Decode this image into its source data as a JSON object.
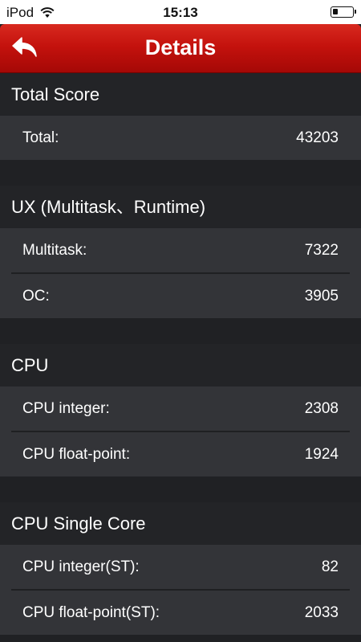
{
  "status_bar": {
    "device": "iPod",
    "time": "15:13",
    "battery_level": 0.25
  },
  "header": {
    "title": "Details",
    "back_icon": "back-arrow-icon",
    "accent_color": "#c4120d"
  },
  "sections": [
    {
      "title": "Total Score",
      "rows": [
        {
          "label": "Total:",
          "value": "43203"
        }
      ]
    },
    {
      "title": "UX (Multitask、Runtime)",
      "rows": [
        {
          "label": "Multitask:",
          "value": "7322"
        },
        {
          "label": "OC:",
          "value": "3905"
        }
      ]
    },
    {
      "title": "CPU",
      "rows": [
        {
          "label": "CPU integer:",
          "value": "2308"
        },
        {
          "label": "CPU float-point:",
          "value": "1924"
        }
      ]
    },
    {
      "title": "CPU Single Core",
      "rows": [
        {
          "label": "CPU integer(ST):",
          "value": "82"
        },
        {
          "label": "CPU float-point(ST):",
          "value": "2033"
        }
      ]
    }
  ]
}
